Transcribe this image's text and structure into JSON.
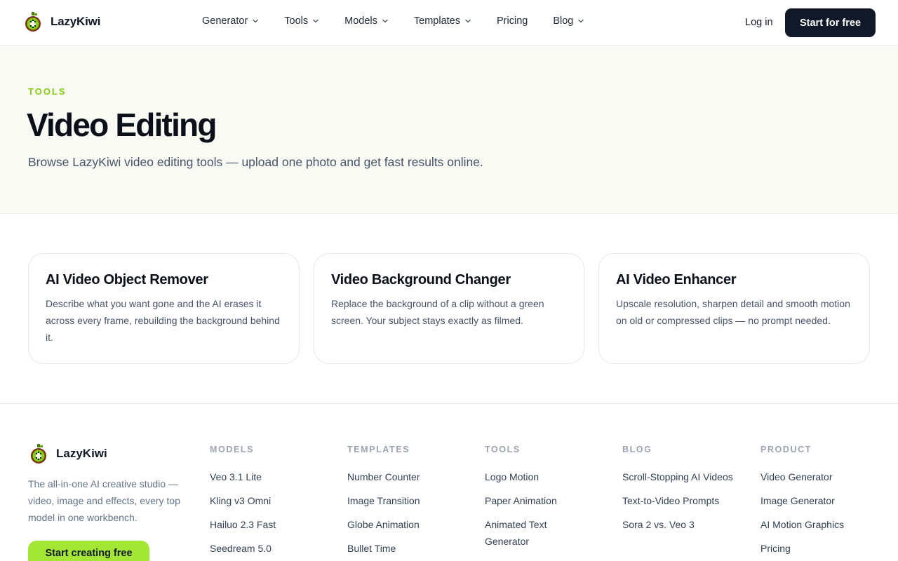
{
  "header": {
    "brand": "LazyKiwi",
    "nav": [
      {
        "label": "Generator",
        "dropdown": true
      },
      {
        "label": "Tools",
        "dropdown": true
      },
      {
        "label": "Models",
        "dropdown": true
      },
      {
        "label": "Templates",
        "dropdown": true
      },
      {
        "label": "Pricing",
        "dropdown": false
      },
      {
        "label": "Blog",
        "dropdown": true
      }
    ],
    "login": "Log in",
    "cta": "Start for free"
  },
  "hero": {
    "eyebrow": "TOOLS",
    "title": "Video Editing",
    "subtitle": "Browse LazyKiwi video editing tools — upload one photo and get fast results online."
  },
  "cards": [
    {
      "title": "AI Video Object Remover",
      "desc": "Describe what you want gone and the AI erases it across every frame, rebuilding the background behind it."
    },
    {
      "title": "Video Background Changer",
      "desc": "Replace the background of a clip without a green screen. Your subject stays exactly as filmed."
    },
    {
      "title": "AI Video Enhancer",
      "desc": "Upscale resolution, sharpen detail and smooth motion on old or compressed clips — no prompt needed."
    }
  ],
  "footer": {
    "brand": "LazyKiwi",
    "desc": "The all-in-one AI creative studio — video, image and effects, every top model in one workbench.",
    "cta": "Start creating free",
    "columns": [
      {
        "heading": "MODELS",
        "links": [
          "Veo 3.1 Lite",
          "Kling v3 Omni",
          "Hailuo 2.3 Fast",
          "Seedream 5.0"
        ]
      },
      {
        "heading": "TEMPLATES",
        "links": [
          "Number Counter",
          "Image Transition",
          "Globe Animation",
          "Bullet Time"
        ]
      },
      {
        "heading": "TOOLS",
        "links": [
          "Logo Motion",
          "Paper Animation",
          "Animated Text Generator"
        ]
      },
      {
        "heading": "BLOG",
        "links": [
          "Scroll-Stopping AI Videos",
          "Text-to-Video Prompts",
          "Sora 2 vs. Veo 3"
        ]
      },
      {
        "heading": "PRODUCT",
        "links": [
          "Video Generator",
          "Image Generator",
          "AI Motion Graphics",
          "Pricing"
        ]
      }
    ]
  },
  "colors": {
    "accent": "#84cc16",
    "cta_dark": "#111827",
    "cta_lime": "#a3e635",
    "hero_bg": "#f9faf4"
  },
  "icons": {
    "brand_logo": "kiwi-logo-icon",
    "dropdown": "chevron-down-icon"
  }
}
